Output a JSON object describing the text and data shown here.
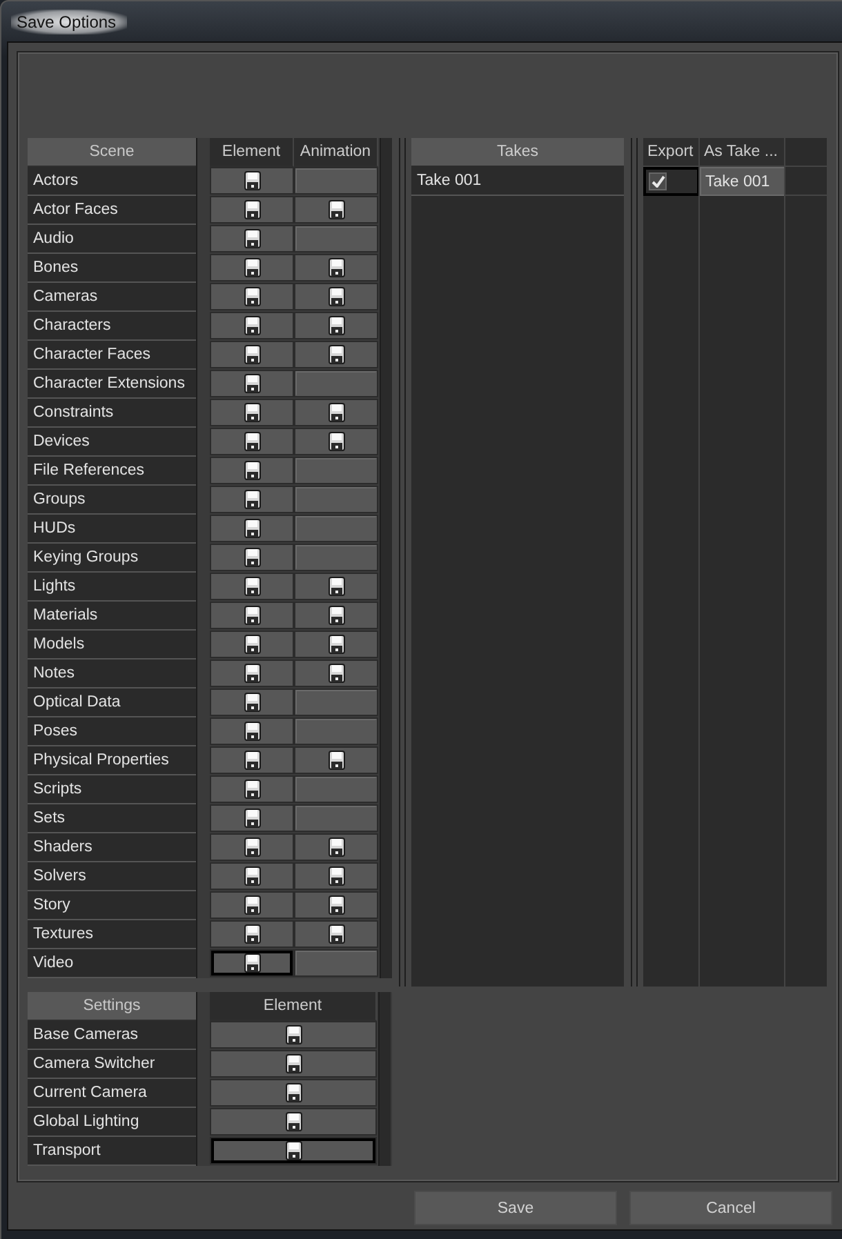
{
  "window": {
    "title": "Save Options"
  },
  "scene_table": {
    "columns": [
      "Scene",
      "Element",
      "Animation"
    ],
    "rows": [
      {
        "name": "Actors",
        "animation": false,
        "focused": false
      },
      {
        "name": "Actor Faces",
        "animation": true,
        "focused": false
      },
      {
        "name": "Audio",
        "animation": false,
        "focused": false
      },
      {
        "name": "Bones",
        "animation": true,
        "focused": false
      },
      {
        "name": "Cameras",
        "animation": true,
        "focused": false
      },
      {
        "name": "Characters",
        "animation": true,
        "focused": false
      },
      {
        "name": "Character Faces",
        "animation": true,
        "focused": false
      },
      {
        "name": "Character Extensions",
        "animation": false,
        "focused": false
      },
      {
        "name": "Constraints",
        "animation": true,
        "focused": false
      },
      {
        "name": "Devices",
        "animation": true,
        "focused": false
      },
      {
        "name": "File References",
        "animation": false,
        "focused": false
      },
      {
        "name": "Groups",
        "animation": false,
        "focused": false
      },
      {
        "name": "HUDs",
        "animation": false,
        "focused": false
      },
      {
        "name": "Keying Groups",
        "animation": false,
        "focused": false
      },
      {
        "name": "Lights",
        "animation": true,
        "focused": false
      },
      {
        "name": "Materials",
        "animation": true,
        "focused": false
      },
      {
        "name": "Models",
        "animation": true,
        "focused": false
      },
      {
        "name": "Notes",
        "animation": true,
        "focused": false
      },
      {
        "name": "Optical Data",
        "animation": false,
        "focused": false
      },
      {
        "name": "Poses",
        "animation": false,
        "focused": false
      },
      {
        "name": "Physical Properties",
        "animation": true,
        "focused": false
      },
      {
        "name": "Scripts",
        "animation": false,
        "focused": false
      },
      {
        "name": "Sets",
        "animation": false,
        "focused": false
      },
      {
        "name": "Shaders",
        "animation": true,
        "focused": false
      },
      {
        "name": "Solvers",
        "animation": true,
        "focused": false
      },
      {
        "name": "Story",
        "animation": true,
        "focused": false
      },
      {
        "name": "Textures",
        "animation": true,
        "focused": false
      },
      {
        "name": "Video",
        "animation": false,
        "focused": true
      }
    ]
  },
  "settings_table": {
    "columns": [
      "Settings",
      "Element"
    ],
    "rows": [
      {
        "name": "Base Cameras",
        "focused": false
      },
      {
        "name": "Camera Switcher",
        "focused": false
      },
      {
        "name": "Current Camera",
        "focused": false
      },
      {
        "name": "Global Lighting",
        "focused": false
      },
      {
        "name": "Transport",
        "focused": true
      }
    ]
  },
  "takes": {
    "header": "Takes",
    "items": [
      {
        "label": "Take 001"
      }
    ]
  },
  "export_table": {
    "columns": [
      "Export",
      "As Take ..."
    ],
    "rows": [
      {
        "checked": true,
        "as_take": "Take 001",
        "focused": true
      }
    ]
  },
  "buttons": [
    "Save",
    "Cancel"
  ]
}
